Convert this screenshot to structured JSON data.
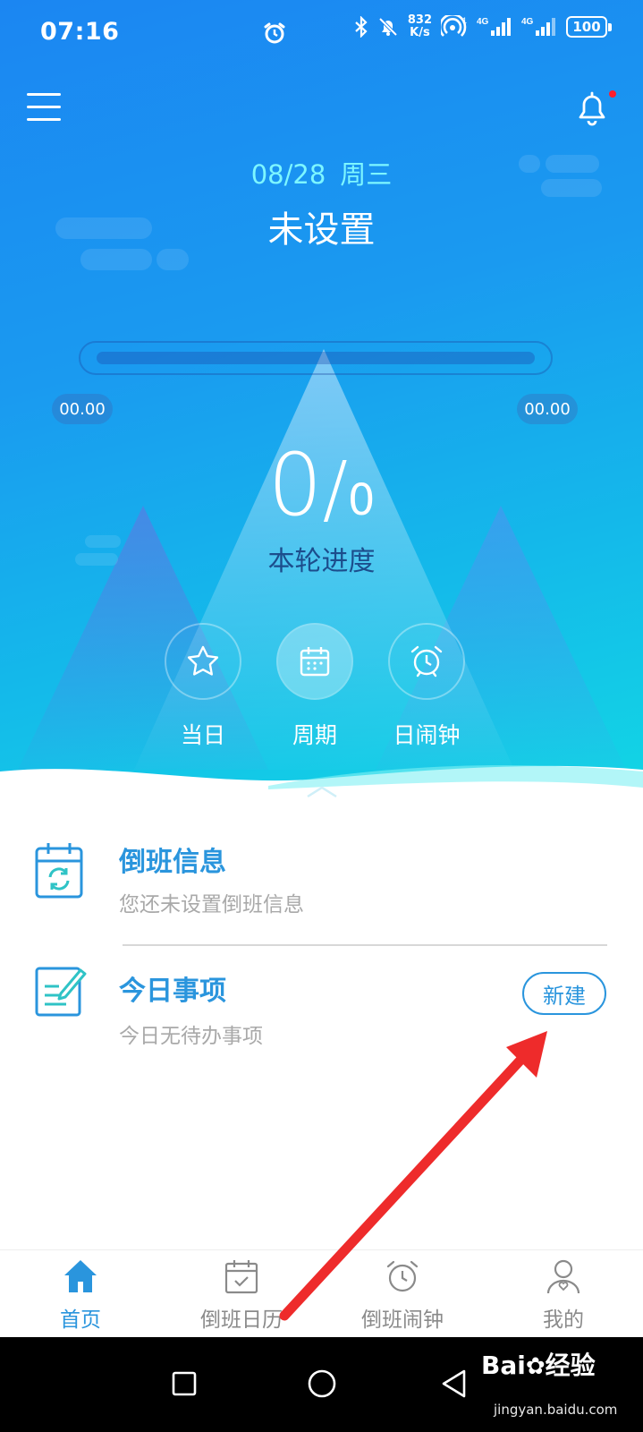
{
  "status_bar": {
    "time": "07:16",
    "net_speed_value": "832",
    "net_speed_unit": "K/s",
    "signal_label_1": "4G",
    "signal_label_2": "4G",
    "battery": "100"
  },
  "header": {
    "date": "08/28",
    "weekday": "周三",
    "shift_status": "未设置"
  },
  "progress": {
    "fraction": 0,
    "start_time": "00.00",
    "end_time": "00.00",
    "current": "0",
    "separator": "/",
    "total": "0",
    "label": "本轮进度"
  },
  "quick_actions": [
    {
      "label": "当日",
      "icon": "star-icon",
      "active": false
    },
    {
      "label": "周期",
      "icon": "calendar-icon",
      "active": true
    },
    {
      "label": "日闹钟",
      "icon": "alarm-clock-icon",
      "active": false
    }
  ],
  "cards": {
    "shift_info": {
      "title": "倒班信息",
      "subtitle": "您还未设置倒班信息",
      "icon": "calendar-sync-icon"
    },
    "today_items": {
      "title": "今日事项",
      "subtitle": "今日无待办事项",
      "icon": "edit-note-icon",
      "action_label": "新建"
    }
  },
  "bottom_nav": [
    {
      "label": "首页",
      "icon": "home-icon",
      "active": true
    },
    {
      "label": "倒班日历",
      "icon": "calendar-check-icon",
      "active": false
    },
    {
      "label": "倒班闹钟",
      "icon": "alarm-clock-icon",
      "active": false
    },
    {
      "label": "我的",
      "icon": "user-icon",
      "active": false
    }
  ],
  "watermark": {
    "brand": "Bai",
    "brand2": "经验",
    "url": "jingyan.baidu.com"
  },
  "colors": {
    "accent": "#2a95dd",
    "hero_gradient_start": "#1b86f2",
    "hero_gradient_end": "#12d8e4",
    "date_color": "#7df6ff",
    "annotation_arrow": "#ee2b2b",
    "notification_dot": "#ff1e2d"
  }
}
